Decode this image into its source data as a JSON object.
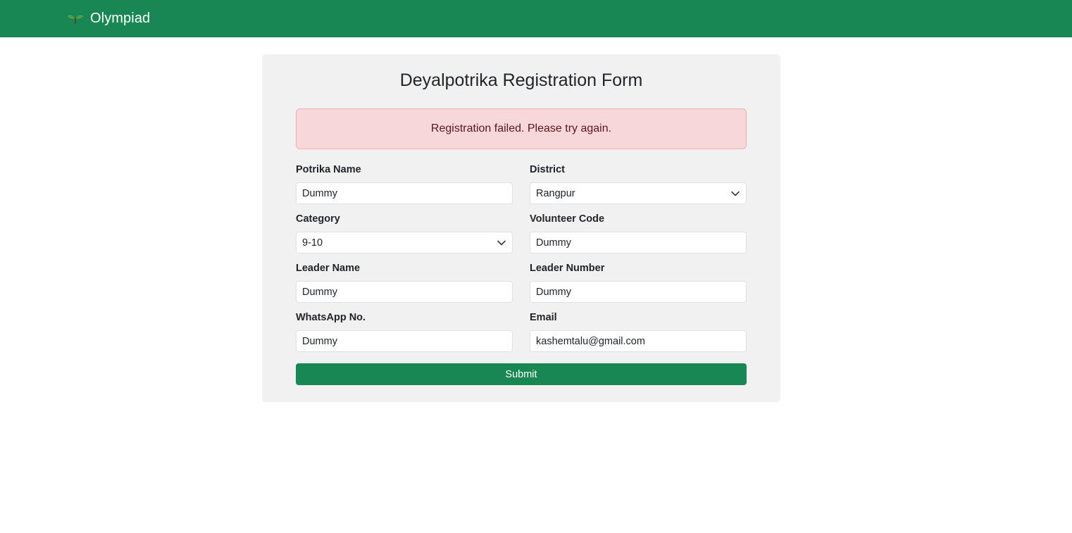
{
  "navbar": {
    "brand_text": "Olympiad",
    "logo_icon": "sprout-icon",
    "bg_color": "#198754"
  },
  "form": {
    "title": "Deyalpotrika Registration Form",
    "alert": {
      "message": "Registration failed. Please try again.",
      "type": "danger"
    },
    "fields": {
      "potrika_name": {
        "label": "Potrika Name",
        "value": "Dummy"
      },
      "district": {
        "label": "District",
        "value": "Rangpur"
      },
      "category": {
        "label": "Category",
        "value": "9-10"
      },
      "volunteer_code": {
        "label": "Volunteer Code",
        "value": "Dummy"
      },
      "leader_name": {
        "label": "Leader Name",
        "value": "Dummy"
      },
      "leader_number": {
        "label": "Leader Number",
        "value": "Dummy"
      },
      "whatsapp_no": {
        "label": "WhatsApp No.",
        "value": "Dummy"
      },
      "email": {
        "label": "Email",
        "value": "kashemtalu@gmail.com"
      }
    },
    "submit_label": "Submit",
    "accent_color": "#198754"
  }
}
